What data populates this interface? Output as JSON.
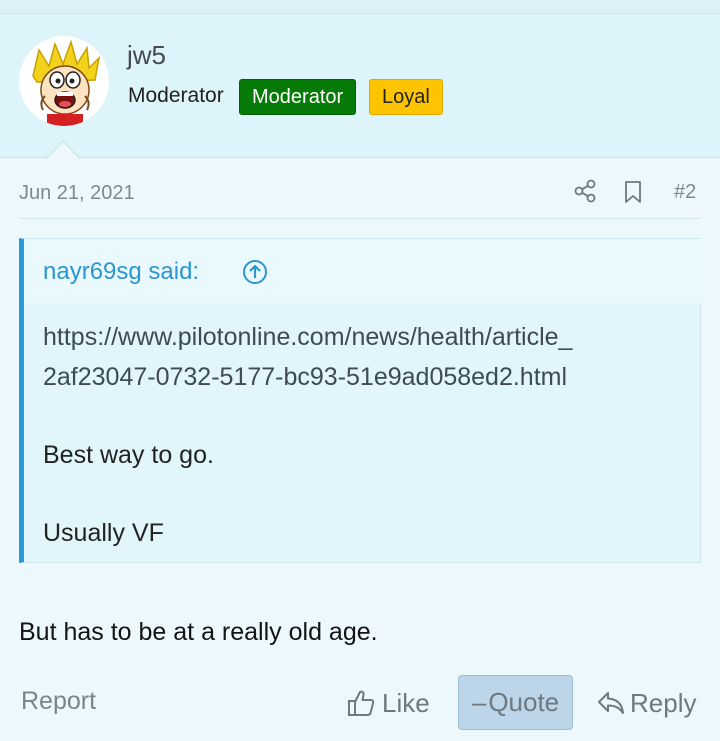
{
  "user": {
    "username": "jw5",
    "title": "Moderator",
    "badges": [
      {
        "label": "Moderator",
        "color": "#067a06"
      },
      {
        "label": "Loyal",
        "color": "#ffc400"
      }
    ],
    "avatar_icon": "cartoon-avatar"
  },
  "post": {
    "date": "Jun 21, 2021",
    "number": "#2",
    "icons": [
      "share-icon",
      "bookmark-icon"
    ],
    "quote": {
      "author_label": "nayr69sg said:",
      "link_line1": "https://www.pilotonline.com/news/health/article_",
      "link_line2": "2af23047-0732-5177-bc93-51e9ad058ed2.html",
      "line1": "Best way to go.",
      "line2": "Usually VF"
    },
    "text": "But has to be at a really old age."
  },
  "actions": {
    "report": "Report",
    "like": "Like",
    "quote": "Quote",
    "reply": "Reply"
  },
  "colors": {
    "accent": "#2a9ad6",
    "header_bg": "#dcf4fa",
    "quote_button_bg": "#bcd5e9"
  }
}
